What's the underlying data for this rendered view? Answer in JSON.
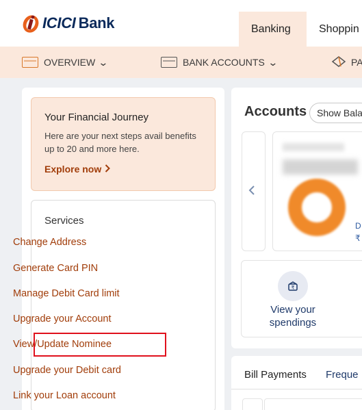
{
  "brand": {
    "name": "ICICI",
    "suffix": "Bank",
    "logo_colors": {
      "primary": "#0b2a5b",
      "accent": "#e8601c"
    }
  },
  "top_tabs": [
    {
      "label": "Banking",
      "active": true
    },
    {
      "label": "Shoppin",
      "active": false
    }
  ],
  "subnav": [
    {
      "label": "OVERVIEW",
      "icon": "card-icon"
    },
    {
      "label": "BANK ACCOUNTS",
      "icon": "card-icon"
    },
    {
      "label": "PA",
      "icon": "pay-icon"
    }
  ],
  "journey": {
    "title": "Your Financial Journey",
    "text": "Here are your next steps avail benefits up to 20 and more here.",
    "link": "Explore now"
  },
  "services": {
    "title": "Services",
    "links": [
      "Change Address",
      "Generate Card PIN",
      "Manage Debit Card limit",
      "Upgrade your Account",
      "View/Update Nominee",
      "Upgrade your Debit card",
      "Link your Loan account"
    ],
    "highlighted_index": 4
  },
  "accounts": {
    "title": "Accounts",
    "show_balance": "Show Bala",
    "card_extra_1": "D",
    "card_extra_2": "₹",
    "spendings": "View your spendings"
  },
  "bill_tabs": {
    "active": "Bill Payments",
    "other": "Freque"
  },
  "colors": {
    "link": "#a13d0a",
    "peach": "#fbe8dc",
    "highlight": "#e0101c",
    "navy": "#1f3a6a"
  }
}
